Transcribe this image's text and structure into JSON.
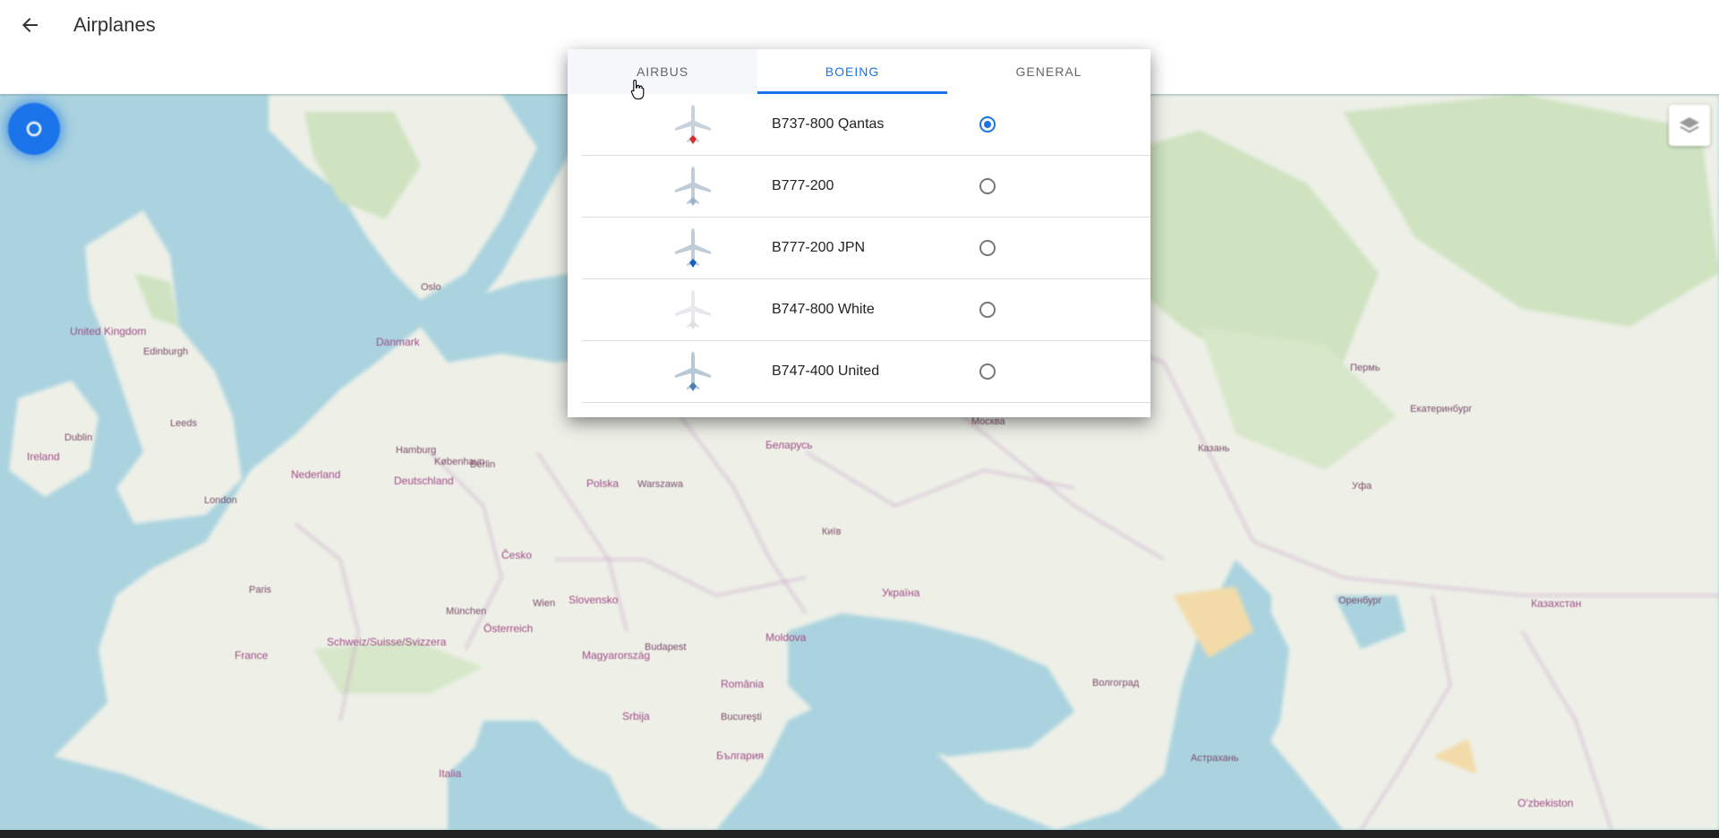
{
  "appbar": {
    "title": "Airplanes",
    "back_icon": "arrow-left-icon"
  },
  "tabs": [
    {
      "label": "AIRBUS",
      "selected": false
    },
    {
      "label": "BOEING",
      "selected": true
    },
    {
      "label": "GENERAL",
      "selected": false
    }
  ],
  "planes": [
    {
      "name": "B737-800 Qantas",
      "selected": true,
      "tail_color": "#d32f2f"
    },
    {
      "name": "B777-200",
      "selected": false,
      "tail_color": "#9fb4c9"
    },
    {
      "name": "B777-200 JPN",
      "selected": false,
      "tail_color": "#1565c0"
    },
    {
      "name": "B747-800 White",
      "selected": false,
      "tail_color": "#e0e0e0"
    },
    {
      "name": "B747-400 United",
      "selected": false,
      "tail_color": "#4a7fb0"
    }
  ],
  "map": {
    "labels": [
      {
        "text": "United Kingdom",
        "kind": "country"
      },
      {
        "text": "Ireland",
        "kind": "country"
      },
      {
        "text": "Danmark",
        "kind": "country"
      },
      {
        "text": "Nederland",
        "kind": "country"
      },
      {
        "text": "Deutschland",
        "kind": "country"
      },
      {
        "text": "Polska",
        "kind": "country"
      },
      {
        "text": "Беларусь",
        "kind": "country"
      },
      {
        "text": "Україна",
        "kind": "country"
      },
      {
        "text": "France",
        "kind": "country"
      },
      {
        "text": "Česko",
        "kind": "country"
      },
      {
        "text": "Österreich",
        "kind": "country"
      },
      {
        "text": "Magyarország",
        "kind": "country"
      },
      {
        "text": "România",
        "kind": "country"
      },
      {
        "text": "Moldova",
        "kind": "country"
      },
      {
        "text": "Srbija",
        "kind": "country"
      },
      {
        "text": "България",
        "kind": "country"
      },
      {
        "text": "Italia",
        "kind": "country"
      },
      {
        "text": "Schweiz/Suisse/Svizzera",
        "kind": "country"
      },
      {
        "text": "Slovensko",
        "kind": "country"
      },
      {
        "text": "Казахстан",
        "kind": "country"
      },
      {
        "text": "O'zbekiston",
        "kind": "country"
      },
      {
        "text": "Edinburgh",
        "kind": "city"
      },
      {
        "text": "Leeds",
        "kind": "city"
      },
      {
        "text": "London",
        "kind": "city"
      },
      {
        "text": "Dublin",
        "kind": "city"
      },
      {
        "text": "Hamburg",
        "kind": "city"
      },
      {
        "text": "Berlin",
        "kind": "city"
      },
      {
        "text": "Warszawa",
        "kind": "city"
      },
      {
        "text": "Київ",
        "kind": "city"
      },
      {
        "text": "Paris",
        "kind": "city"
      },
      {
        "text": "München",
        "kind": "city"
      },
      {
        "text": "Wien",
        "kind": "city"
      },
      {
        "text": "Budapest",
        "kind": "city"
      },
      {
        "text": "Bucureşti",
        "kind": "city"
      },
      {
        "text": "Пермь",
        "kind": "city"
      },
      {
        "text": "Екатеринбург",
        "kind": "city"
      },
      {
        "text": "Казань",
        "kind": "city"
      },
      {
        "text": "Уфа",
        "kind": "city"
      },
      {
        "text": "Оренбург",
        "kind": "city"
      },
      {
        "text": "Волгоград",
        "kind": "city"
      },
      {
        "text": "Астрахань",
        "kind": "city"
      },
      {
        "text": "Москва",
        "kind": "city"
      },
      {
        "text": "Oslo",
        "kind": "city"
      },
      {
        "text": "København",
        "kind": "city"
      }
    ],
    "locate_icon": "my-location-icon",
    "layers_icon": "layers-icon"
  }
}
